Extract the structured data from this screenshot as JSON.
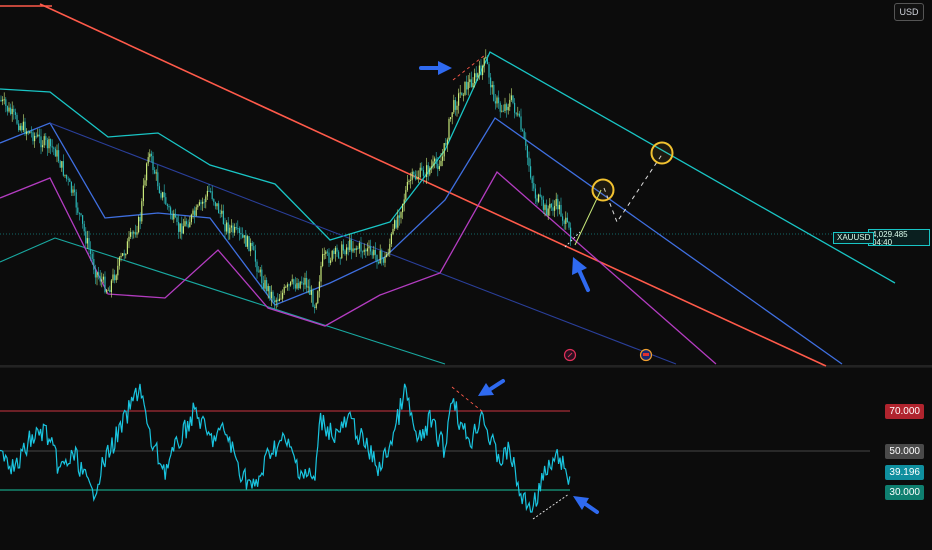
{
  "header": {
    "currency_label": "USD"
  },
  "price_badge": {
    "symbol": "XAUUSD",
    "price": "4,029.485",
    "countdown": "04:40"
  },
  "rsi_levels": {
    "upper": "70.000",
    "middle": "50.000",
    "current": "39.196",
    "lower": "30.000"
  },
  "colors": {
    "background": "#0c0c0c",
    "candle_up": "#c8e87a",
    "candle_down": "#2ab8b8",
    "red_trendline": "#ff5a4a",
    "cyan_channel": "#19c5c5",
    "blue_channel": "#3f6fe0",
    "purple_channel": "#b33cc0",
    "rsi_line": "#19c5e0",
    "level_70": "#cc3340",
    "level_50": "#5a5a5a",
    "level_30": "#19c5a0",
    "arrow": "#2f6af0",
    "circle": "#f2c230"
  },
  "icons": [
    "arrow-right-icon",
    "arrow-up-icon",
    "arrow-down-left-icon",
    "arrow-up-left-icon",
    "target-circle-icon",
    "event-flag-icon"
  ],
  "chart_data": [
    {
      "type": "candlestick",
      "symbol": "XAUUSD",
      "last_price": 4029.485,
      "overlays": [
        "descending red trendline",
        "cyan channel",
        "blue channel",
        "purple channel"
      ],
      "grid": false
    },
    {
      "type": "line",
      "name": "RSI",
      "levels": [
        70,
        50,
        30
      ],
      "current_value": 39.196,
      "grid": false
    }
  ]
}
